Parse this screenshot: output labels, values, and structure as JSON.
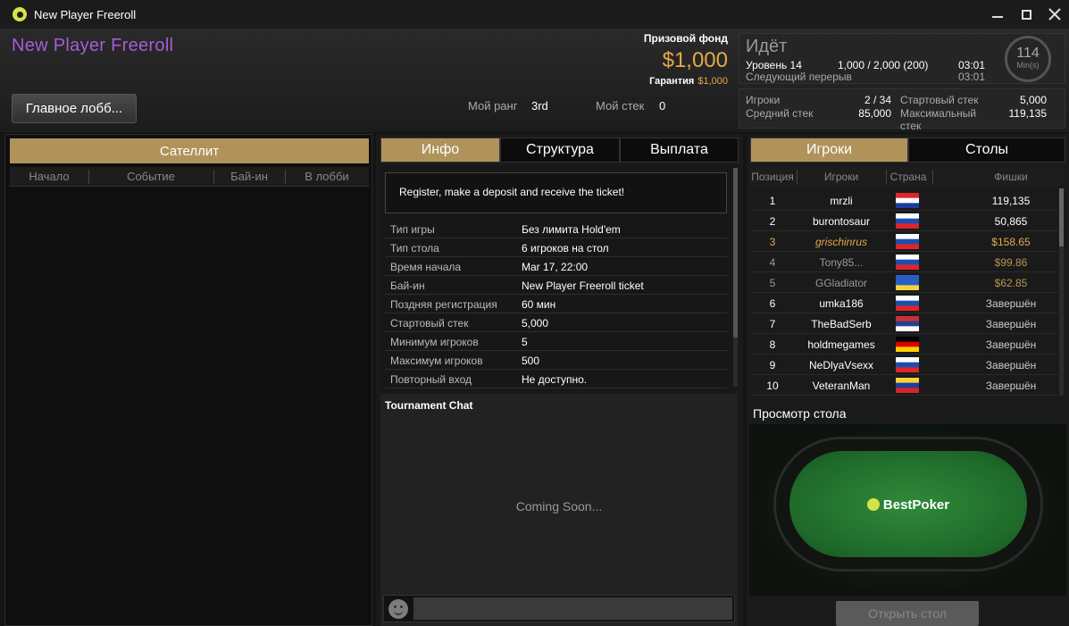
{
  "window": {
    "title": "New Player Freeroll"
  },
  "header": {
    "tournament_name": "New Player Freeroll",
    "lobby_button": "Главное лобб...",
    "rank_label": "Мой ранг",
    "rank_value": "3rd",
    "stack_label": "Мой стек",
    "stack_value": "0",
    "prize_label": "Призовой фонд",
    "prize_value": "$1,000",
    "guarantee_label": "Гарантия",
    "guarantee_value": "$1,000"
  },
  "status": {
    "state": "Идёт",
    "level_label": "Уровень 14",
    "blinds": "1,000 / 2,000 (200)",
    "level_time": "03:01",
    "next_break_label": "Следующий перерыв",
    "next_break_time": "03:01",
    "clock_value": "114",
    "clock_unit": "Min(s)"
  },
  "stats": {
    "players_label": "Игроки",
    "players_value": "2 / 34",
    "avg_stack_label": "Средний стек",
    "avg_stack_value": "85,000",
    "start_stack_label": "Стартовый стек",
    "start_stack_value": "5,000",
    "max_stack_label": "Максимальный стек",
    "max_stack_value": "119,135"
  },
  "satellite": {
    "header": "Сателлит",
    "columns": [
      "Начало",
      "Событие",
      "Бай-ин",
      "В лобби"
    ]
  },
  "info_tabs": [
    "Инфо",
    "Структура",
    "Выплата"
  ],
  "info": {
    "notice": "Register, make a deposit and receive the ticket!",
    "rows": [
      {
        "key": "Тип игры",
        "value": "Без лимита Hold'em"
      },
      {
        "key": "Тип стола",
        "value": "6 игроков на стол"
      },
      {
        "key": "Время начала",
        "value": "Mar 17, 22:00"
      },
      {
        "key": "Бай-ин",
        "value": "New Player Freeroll ticket"
      },
      {
        "key": "Поздняя регистрация",
        "value": "60 мин"
      },
      {
        "key": "Стартовый стек",
        "value": "5,000"
      },
      {
        "key": "Минимум игроков",
        "value": "5"
      },
      {
        "key": "Максимум игроков",
        "value": "500"
      },
      {
        "key": "Повторный вход",
        "value": "Не доступно."
      }
    ]
  },
  "chat": {
    "title": "Tournament Chat",
    "placeholder_text": "Coming Soon..."
  },
  "player_tabs": [
    "Игроки",
    "Столы"
  ],
  "players": {
    "columns": [
      "Позиция",
      "Игроки",
      "Страна",
      "Фишки"
    ],
    "rows": [
      {
        "pos": "1",
        "name": "mrzli",
        "chips": "119,135",
        "country": "croatia-flag"
      },
      {
        "pos": "2",
        "name": "burontosaur",
        "chips": "50,865",
        "country": "slovakia-flag"
      },
      {
        "pos": "3",
        "name": "grischinrus",
        "chips": "$158.65",
        "country": "russia-flag"
      },
      {
        "pos": "4",
        "name": "Tony85...",
        "chips": "$99.86",
        "country": "slovakia-flag"
      },
      {
        "pos": "5",
        "name": "GGladiator",
        "chips": "$62.85",
        "country": "ukraine-flag"
      },
      {
        "pos": "6",
        "name": "umka186",
        "chips": "Завершён",
        "country": "russia-flag"
      },
      {
        "pos": "7",
        "name": "TheBadSerb",
        "chips": "Завершён",
        "country": "serbia-flag"
      },
      {
        "pos": "8",
        "name": "holdmegames",
        "chips": "Завершён",
        "country": "germany-flag"
      },
      {
        "pos": "9",
        "name": "NeDlyaVsexx",
        "chips": "Завершён",
        "country": "russia-flag"
      },
      {
        "pos": "10",
        "name": "VeteranMan",
        "chips": "Завершён",
        "country": "venezuela-flag"
      }
    ]
  },
  "preview": {
    "title": "Просмотр стола",
    "brand": "BestPoker",
    "open_button": "Открыть стол"
  },
  "colors": {
    "accent_gold": "#b0935a",
    "prize_gold": "#e5a94a",
    "name_purple": "#a75bd8",
    "felt_green": "#2f8a3a"
  }
}
